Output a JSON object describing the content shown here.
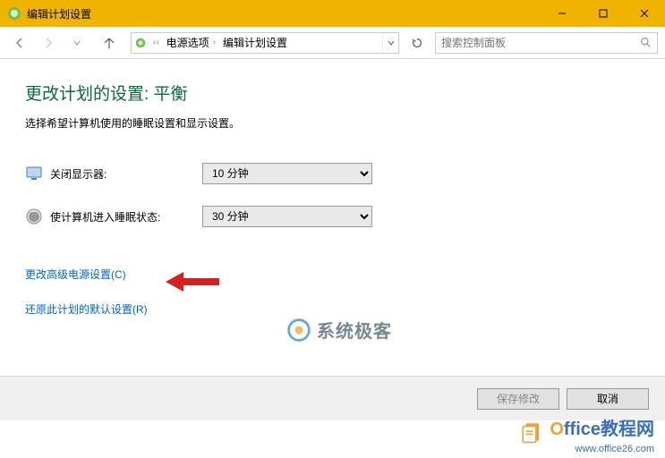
{
  "titlebar": {
    "title": "编辑计划设置"
  },
  "nav": {
    "crumb1": "电源选项",
    "crumb2": "编辑计划设置",
    "search_placeholder": "搜索控制面板"
  },
  "content": {
    "heading": "更改计划的设置: 平衡",
    "subtext": "选择希望计算机使用的睡眠设置和显示设置。",
    "row_display_label": "关闭显示器:",
    "row_display_value": "10 分钟",
    "row_sleep_label": "使计算机进入睡眠状态:",
    "row_sleep_value": "30 分钟",
    "link_advanced": "更改高级电源设置(C)",
    "link_restore": "还原此计划的默认设置(R)"
  },
  "buttons": {
    "save": "保存修改",
    "cancel": "取消"
  },
  "watermark": {
    "center_text": "系统极客",
    "br_line1_prefix": "O",
    "br_line1_rest": "ffice教程网",
    "br_line2": "www.office26.com"
  }
}
